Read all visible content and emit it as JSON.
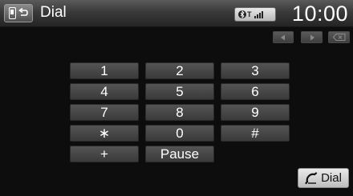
{
  "header": {
    "title": "Dial",
    "clock": "10:00",
    "status_icons": [
      "bluetooth-icon",
      "signal-icon"
    ]
  },
  "nav": {
    "icons": [
      "left-arrow-icon",
      "right-arrow-icon",
      "backspace-icon"
    ]
  },
  "keypad": {
    "rows": [
      [
        "1",
        "2",
        "3"
      ],
      [
        "4",
        "5",
        "6"
      ],
      [
        "7",
        "8",
        "9"
      ],
      [
        "∗",
        "0",
        "#"
      ],
      [
        "+",
        "Pause"
      ]
    ]
  },
  "dial_button": {
    "label": "Dial",
    "icon": "handset-icon"
  },
  "colors": {
    "background": "#0d0d0d",
    "key_face": "#474747",
    "header": "#3a3a3a",
    "dial_button": "#d6d6d6"
  }
}
